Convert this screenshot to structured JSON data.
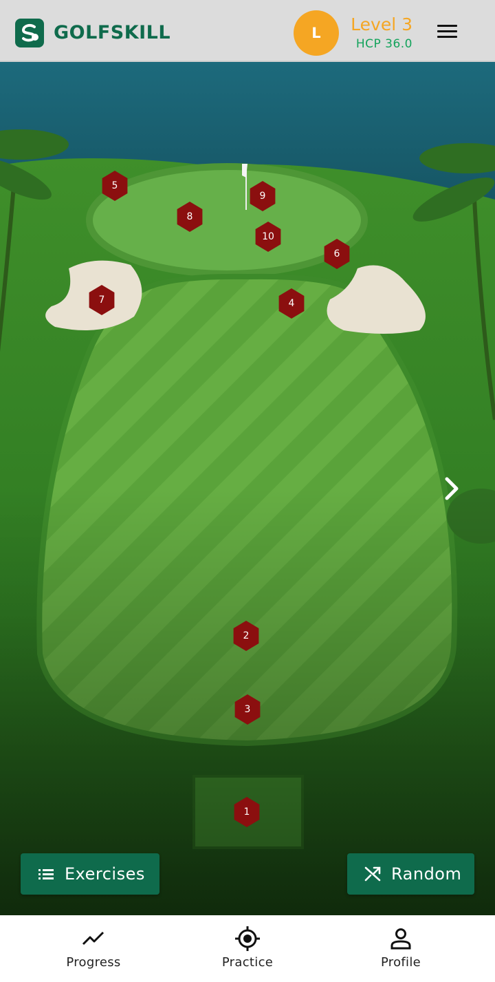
{
  "header": {
    "brand": "GOLFSKILL",
    "avatar_initial": "L",
    "level": "Level 3",
    "hcp": "HCP 36.0"
  },
  "map": {
    "stations": [
      {
        "label": "1"
      },
      {
        "label": "2"
      },
      {
        "label": "3"
      },
      {
        "label": "4"
      },
      {
        "label": "5"
      },
      {
        "label": "6"
      },
      {
        "label": "7"
      },
      {
        "label": "8"
      },
      {
        "label": "9"
      },
      {
        "label": "10"
      }
    ]
  },
  "actions": {
    "exercises_label": "Exercises",
    "random_label": "Random"
  },
  "nav": {
    "progress": "Progress",
    "practice": "Practice",
    "profile": "Profile"
  },
  "colors": {
    "brand_green": "#0f6b4c",
    "accent_orange": "#f5a623",
    "hcp_green": "#14a35c",
    "station_red": "#8b0f0f"
  },
  "icons": {
    "logo": "golfskill-logo-icon",
    "menu": "hamburger-menu-icon",
    "next": "chevron-right-icon",
    "exercises": "list-icon",
    "random": "shuffle-icon",
    "progress": "trend-line-icon",
    "practice": "crosshair-icon",
    "profile": "person-icon"
  }
}
